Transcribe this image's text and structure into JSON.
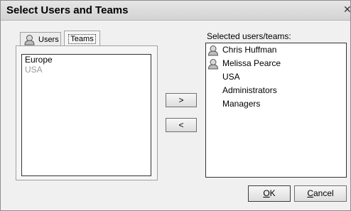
{
  "window": {
    "title": "Select Users and Teams"
  },
  "tabs": {
    "users_label": "Users",
    "teams_label": "Teams"
  },
  "teams_list": {
    "items": [
      "Europe",
      "USA"
    ]
  },
  "buttons": {
    "add": ">",
    "remove": "<",
    "ok_accel": "O",
    "ok_rest": "K",
    "cancel_accel": "C",
    "cancel_rest": "ancel"
  },
  "selected": {
    "label": "Selected users/teams:",
    "items": [
      {
        "label": "Chris Huffman",
        "icon": "user-icon"
      },
      {
        "label": "Melissa Pearce",
        "icon": "user-icon"
      },
      {
        "label": "USA",
        "icon": ""
      },
      {
        "label": "Administrators",
        "icon": ""
      },
      {
        "label": "Managers",
        "icon": ""
      }
    ]
  }
}
